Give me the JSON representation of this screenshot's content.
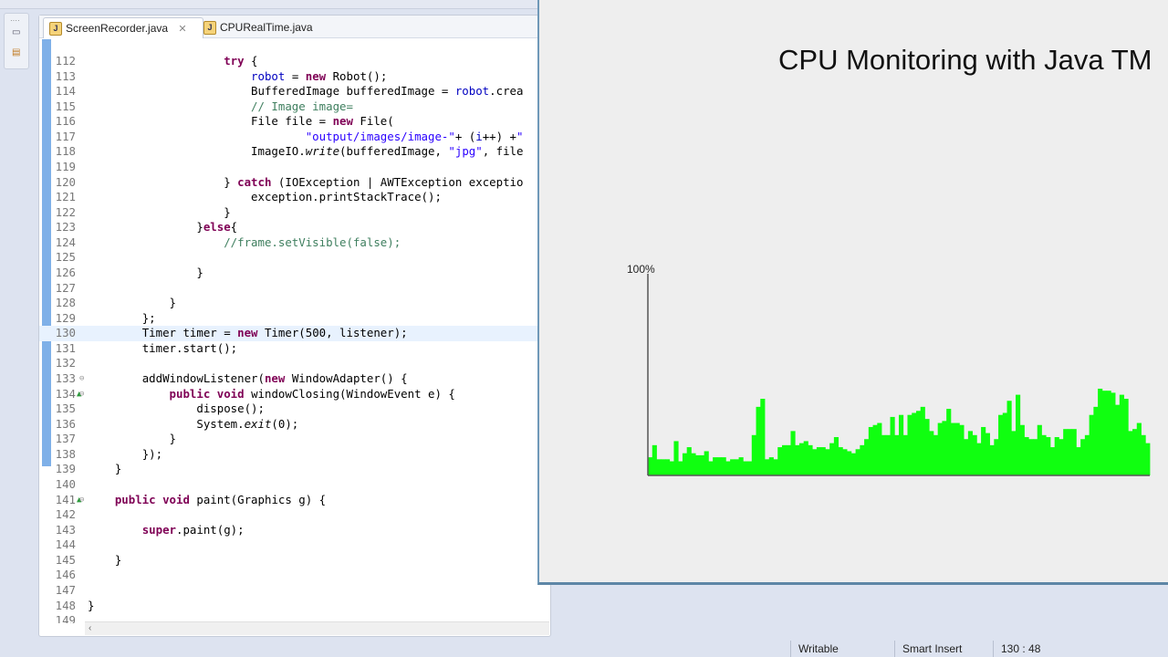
{
  "editor": {
    "tabs": [
      {
        "label": "ScreenRecorder.java",
        "active": true,
        "close": "✕"
      },
      {
        "label": "CPURealTime.java",
        "active": false
      }
    ],
    "current_line": 130,
    "lines": [
      {
        "n": 112,
        "indent": 20,
        "tokens": [
          [
            "try",
            "kw"
          ],
          [
            " {",
            ""
          ]
        ]
      },
      {
        "n": 113,
        "indent": 24,
        "tokens": [
          [
            "robot",
            "fld"
          ],
          [
            " = ",
            ""
          ],
          [
            "new",
            "kw"
          ],
          [
            " Robot();",
            ""
          ]
        ]
      },
      {
        "n": 114,
        "indent": 24,
        "tokens": [
          [
            "BufferedImage bufferedImage = ",
            ""
          ],
          [
            "robot",
            "fld"
          ],
          [
            ".crea",
            ""
          ]
        ]
      },
      {
        "n": 115,
        "indent": 24,
        "tokens": [
          [
            "// Image image=",
            "cm"
          ]
        ]
      },
      {
        "n": 116,
        "indent": 24,
        "tokens": [
          [
            "File file = ",
            ""
          ],
          [
            "new",
            "kw"
          ],
          [
            " File(",
            ""
          ]
        ]
      },
      {
        "n": 117,
        "indent": 32,
        "tokens": [
          [
            "\"output/images/image-\"",
            "str"
          ],
          [
            "+ (",
            ""
          ],
          [
            "i",
            "fld"
          ],
          [
            "++) +",
            ""
          ],
          [
            "\"",
            "str"
          ]
        ]
      },
      {
        "n": 118,
        "indent": 24,
        "tokens": [
          [
            "ImageIO.",
            ""
          ],
          [
            "write",
            "it"
          ],
          [
            "(bufferedImage, ",
            ""
          ],
          [
            "\"jpg\"",
            "str"
          ],
          [
            ", file",
            ""
          ]
        ]
      },
      {
        "n": 119,
        "indent": 0,
        "tokens": []
      },
      {
        "n": 120,
        "indent": 20,
        "tokens": [
          [
            "} ",
            ""
          ],
          [
            "catch",
            "kw"
          ],
          [
            " (IOException | AWTException exceptio",
            ""
          ]
        ]
      },
      {
        "n": 121,
        "indent": 24,
        "tokens": [
          [
            "exception.printStackTrace();",
            ""
          ]
        ]
      },
      {
        "n": 122,
        "indent": 20,
        "tokens": [
          [
            "}",
            ""
          ]
        ]
      },
      {
        "n": 123,
        "indent": 16,
        "tokens": [
          [
            "}",
            ""
          ],
          [
            "else",
            "kw"
          ],
          [
            "{",
            ""
          ]
        ]
      },
      {
        "n": 124,
        "indent": 20,
        "tokens": [
          [
            "//frame.setVisible(false);",
            "cm"
          ]
        ]
      },
      {
        "n": 125,
        "indent": 0,
        "tokens": []
      },
      {
        "n": 126,
        "indent": 16,
        "tokens": [
          [
            "}",
            ""
          ]
        ]
      },
      {
        "n": 127,
        "indent": 0,
        "tokens": []
      },
      {
        "n": 128,
        "indent": 12,
        "tokens": [
          [
            "}",
            ""
          ]
        ]
      },
      {
        "n": 129,
        "indent": 8,
        "tokens": [
          [
            "};",
            ""
          ]
        ]
      },
      {
        "n": 130,
        "indent": 8,
        "tokens": [
          [
            "Timer timer = ",
            ""
          ],
          [
            "new",
            "kw"
          ],
          [
            " Timer(500, listener);",
            ""
          ]
        ]
      },
      {
        "n": 131,
        "indent": 8,
        "tokens": [
          [
            "timer.start();",
            ""
          ]
        ]
      },
      {
        "n": 132,
        "indent": 0,
        "tokens": []
      },
      {
        "n": 133,
        "indent": 8,
        "fold": "⊖",
        "tokens": [
          [
            "addWindowListener(",
            ""
          ],
          [
            "new",
            "kw"
          ],
          [
            " WindowAdapter() {",
            ""
          ]
        ]
      },
      {
        "n": 134,
        "indent": 12,
        "marker": "▲",
        "fold": "⊖",
        "tokens": [
          [
            "public",
            "kw"
          ],
          [
            " ",
            ""
          ],
          [
            "void",
            "kw"
          ],
          [
            " windowClosing(WindowEvent e) {",
            ""
          ]
        ]
      },
      {
        "n": 135,
        "indent": 16,
        "tokens": [
          [
            "dispose();",
            ""
          ]
        ]
      },
      {
        "n": 136,
        "indent": 16,
        "tokens": [
          [
            "System.",
            ""
          ],
          [
            "exit",
            "it"
          ],
          [
            "(0);",
            ""
          ]
        ]
      },
      {
        "n": 137,
        "indent": 12,
        "tokens": [
          [
            "}",
            ""
          ]
        ]
      },
      {
        "n": 138,
        "indent": 8,
        "tokens": [
          [
            "});",
            ""
          ]
        ]
      },
      {
        "n": 139,
        "indent": 4,
        "tokens": [
          [
            "}",
            ""
          ]
        ]
      },
      {
        "n": 140,
        "indent": 0,
        "tokens": []
      },
      {
        "n": 141,
        "indent": 4,
        "marker": "▲",
        "fold": "⊖",
        "tokens": [
          [
            "public",
            "kw"
          ],
          [
            " ",
            ""
          ],
          [
            "void",
            "kw"
          ],
          [
            " paint(Graphics g) {",
            ""
          ]
        ]
      },
      {
        "n": 142,
        "indent": 0,
        "tokens": []
      },
      {
        "n": 143,
        "indent": 8,
        "tokens": [
          [
            "super",
            "kw"
          ],
          [
            ".paint(g);",
            ""
          ]
        ]
      },
      {
        "n": 144,
        "indent": 0,
        "tokens": []
      },
      {
        "n": 145,
        "indent": 4,
        "tokens": [
          [
            "}",
            ""
          ]
        ]
      },
      {
        "n": 146,
        "indent": 0,
        "tokens": []
      },
      {
        "n": 147,
        "indent": 0,
        "tokens": []
      },
      {
        "n": 148,
        "indent": 0,
        "tokens": [
          [
            "}",
            ""
          ]
        ]
      },
      {
        "n": 149,
        "indent": 0,
        "tokens": []
      }
    ],
    "scroll_left": "‹"
  },
  "status": {
    "writable": "Writable",
    "insert_mode": "Smart Insert",
    "position": "130 : 48"
  },
  "app": {
    "title": "CPU Monitoring with Java TM",
    "bar_color": "#10ff10"
  },
  "chart_data": {
    "type": "bar",
    "title": "CPU Monitoring with Java TM",
    "ylabel_top": "100%",
    "ylim": [
      0,
      100
    ],
    "unit": "percent",
    "values": [
      9,
      15,
      8,
      8,
      8,
      7,
      17,
      7,
      11,
      14,
      11,
      10,
      10,
      12,
      7,
      9,
      9,
      9,
      7,
      8,
      8,
      9,
      7,
      7,
      20,
      34,
      38,
      8,
      9,
      8,
      14,
      15,
      15,
      22,
      15,
      16,
      17,
      15,
      13,
      14,
      14,
      13,
      16,
      19,
      14,
      13,
      12,
      11,
      13,
      15,
      18,
      24,
      25,
      26,
      20,
      20,
      29,
      20,
      30,
      20,
      30,
      31,
      32,
      34,
      28,
      22,
      20,
      26,
      27,
      33,
      26,
      26,
      25,
      18,
      22,
      20,
      16,
      24,
      21,
      15,
      18,
      30,
      31,
      37,
      22,
      40,
      25,
      19,
      18,
      18,
      25,
      20,
      19,
      14,
      19,
      18,
      23,
      23,
      23,
      14,
      18,
      20,
      30,
      34,
      43,
      42,
      42,
      41,
      35,
      40,
      38,
      22,
      23,
      26,
      20,
      16
    ]
  }
}
